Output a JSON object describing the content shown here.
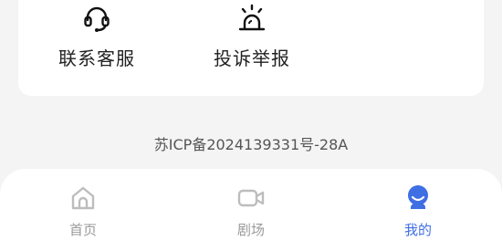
{
  "service_card": {
    "actions": [
      {
        "label": "联系客服",
        "icon": "headset-icon"
      },
      {
        "label": "投诉举报",
        "icon": "alarm-light-icon"
      }
    ]
  },
  "footer": {
    "icp": "苏ICP备2024139331号-28A"
  },
  "tabbar": {
    "accent_color": "#3f6fe3",
    "inactive_color": "#9a9a9a",
    "tabs": [
      {
        "label": "首页",
        "icon": "home-icon",
        "active": false
      },
      {
        "label": "剧场",
        "icon": "video-camera-icon",
        "active": false
      },
      {
        "label": "我的",
        "icon": "profile-icon",
        "active": true
      }
    ]
  }
}
